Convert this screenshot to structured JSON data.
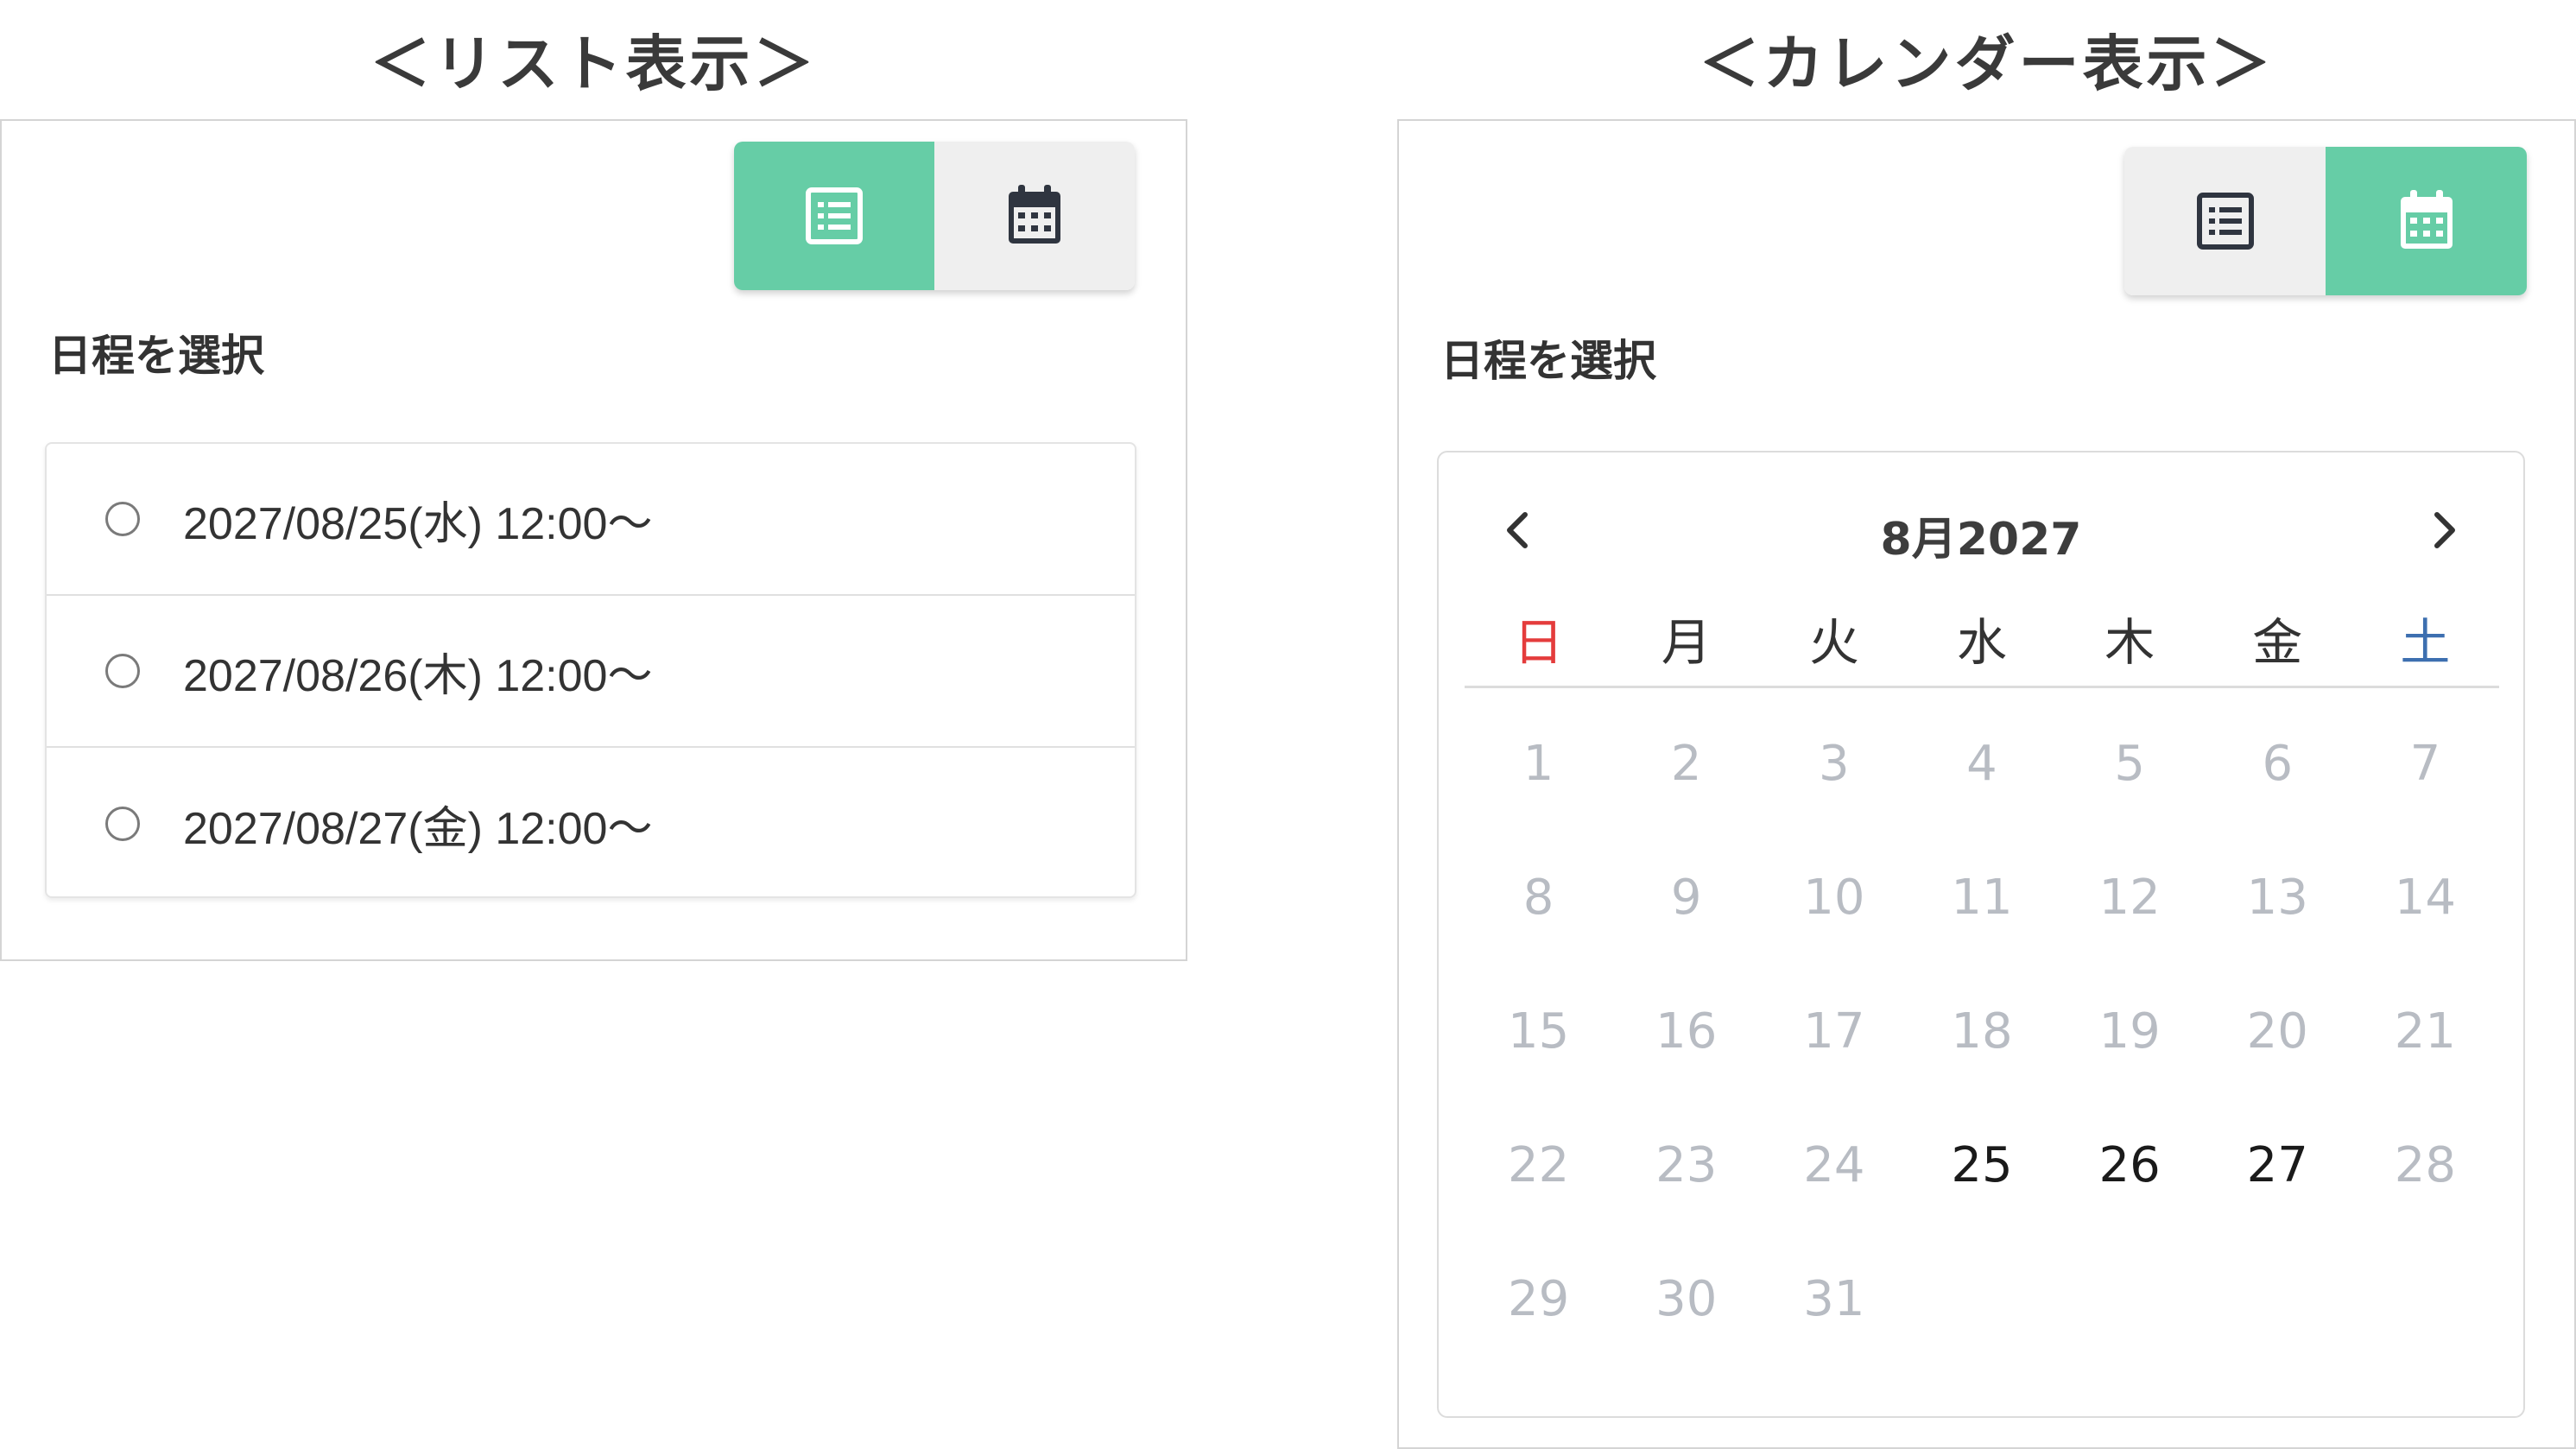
{
  "list_view": {
    "title": "＜リスト表示＞",
    "toggle": {
      "list_icon": "list-icon",
      "calendar_icon": "calendar-icon",
      "active": "list"
    },
    "select_label": "日程を選択",
    "options": [
      "2027/08/25(水) 12:00〜",
      "2027/08/26(木) 12:00〜",
      "2027/08/27(金) 12:00〜"
    ]
  },
  "calendar_view": {
    "title": "＜カレンダー表示＞",
    "toggle": {
      "list_icon": "list-icon",
      "calendar_icon": "calendar-icon",
      "active": "calendar"
    },
    "select_label": "日程を選択",
    "month_title": "8月2027",
    "prev_icon": "chevron-left-icon",
    "next_icon": "chevron-right-icon",
    "weekdays": [
      "日",
      "月",
      "火",
      "水",
      "木",
      "金",
      "土"
    ],
    "weeks": [
      [
        "1",
        "2",
        "3",
        "4",
        "5",
        "6",
        "7"
      ],
      [
        "8",
        "9",
        "10",
        "11",
        "12",
        "13",
        "14"
      ],
      [
        "15",
        "16",
        "17",
        "18",
        "19",
        "20",
        "21"
      ],
      [
        "22",
        "23",
        "24",
        "25",
        "26",
        "27",
        "28"
      ],
      [
        "29",
        "30",
        "31",
        "",
        "",
        "",
        ""
      ]
    ],
    "available_days": [
      "25",
      "26",
      "27"
    ]
  },
  "colors": {
    "accent": "#66cda6",
    "toggle_inactive": "#efefef",
    "sunday": "#e43c3c",
    "saturday": "#3d6fb0",
    "disabled_day": "#b8bcc3"
  }
}
